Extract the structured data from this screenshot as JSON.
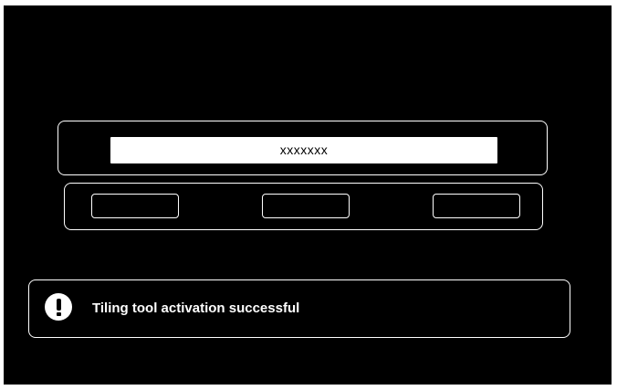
{
  "input": {
    "value": "xxxxxxx"
  },
  "buttons": [
    {
      "label": ""
    },
    {
      "label": ""
    },
    {
      "label": ""
    }
  ],
  "notification": {
    "icon": "exclamation-icon",
    "message": "Tiling tool activation successful"
  },
  "colors": {
    "background": "#000000",
    "foreground": "#ffffff"
  }
}
